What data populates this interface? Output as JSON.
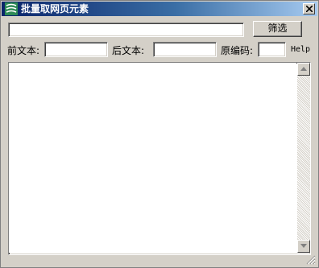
{
  "window": {
    "title": "批量取网页元素"
  },
  "toolbar": {
    "url_value": "",
    "filter_button": "筛选"
  },
  "fields": {
    "prefix_label": "前文本:",
    "prefix_value": "",
    "suffix_label": "后文本:",
    "suffix_value": "",
    "encoding_label": "原编码:",
    "encoding_value": "",
    "help_label": "Help"
  },
  "output": {
    "text": ""
  },
  "icons": {
    "app": "app-logo-icon",
    "close": "close-icon",
    "scroll_up": "arrow-up-icon",
    "scroll_down": "arrow-down-icon"
  },
  "colors": {
    "titlebar_start": "#0a246a",
    "titlebar_end": "#a6caf0",
    "face": "#d4d0c8"
  }
}
